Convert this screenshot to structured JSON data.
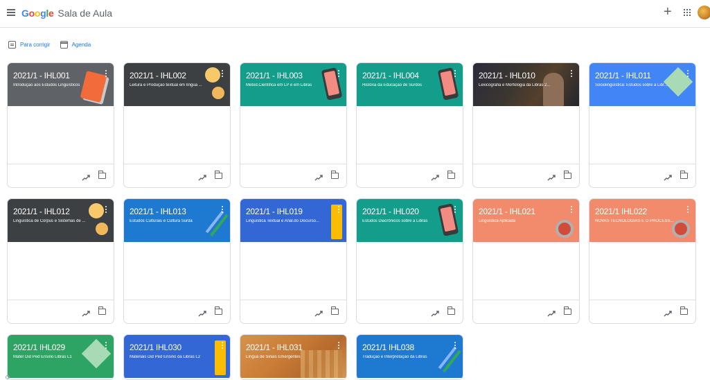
{
  "header": {
    "google_letters": [
      "G",
      "o",
      "o",
      "g",
      "l",
      "e"
    ],
    "app_name": "Sala de Aula"
  },
  "actions": {
    "review_label": "Para corrigir",
    "agenda_label": "Agenda"
  },
  "cards": [
    {
      "title": "2021/1 - IHL001",
      "subtitle": "Introdução aos Estudos Linguísticos",
      "color": "#5f6368"
    },
    {
      "title": "2021/1 - IHL002",
      "subtitle": "Leitura e Produção textual em língua ...",
      "color": "#3c4043"
    },
    {
      "title": "2021/1 - IHL003",
      "subtitle": "Metod.Científica em LP e em Libras",
      "color": "#129e8a"
    },
    {
      "title": "2021/1 - IHL004",
      "subtitle": "História da Educação de Surdos",
      "color": "#129e8a"
    },
    {
      "title": "2021/1 - IHL010",
      "subtitle": "Lexicografia e Morfologia da Libras 2...",
      "color": "#2c2b3a"
    },
    {
      "title": "2021/1 - IHL011",
      "subtitle": "Sociolinguística: Estudos sobre a Libr...",
      "color": "#4285f4"
    },
    {
      "title": "2021/1 - IHL012",
      "subtitle": "Linguística de Corpus e Sistemas de ...",
      "color": "#3c4043"
    },
    {
      "title": "2021/1 - IHL013",
      "subtitle": "Estudos Culturais e Cultura Surda",
      "color": "#1e7ad0"
    },
    {
      "title": "2021/1 - IHL019",
      "subtitle": "Linguística Textual e Anál.do Discurso...",
      "color": "#3367d6"
    },
    {
      "title": "2021/1 - IHL020",
      "subtitle": "Estudos Diacrônicos sobre a Libras",
      "color": "#129e8a"
    },
    {
      "title": "2021/1 - IHL021",
      "subtitle": "Linguística Aplicada",
      "color": "#f28b6b"
    },
    {
      "title": "2021/1 IHL022",
      "subtitle": "NOVAS TECNOLOGIAS E O PROCESS...",
      "color": "#f28b6b"
    },
    {
      "title": "2021/1 IHL029",
      "subtitle": "Mater Did Ped Ensino Libras L1",
      "color": "#2ea464"
    },
    {
      "title": "2021/1 IHL030",
      "subtitle": "Materiais Did Ped Ensino da Libras L2",
      "color": "#3367d6"
    },
    {
      "title": "2021/1 - IHL031",
      "subtitle": "Língua de Sinais Emergentes",
      "color": "#c87b35"
    },
    {
      "title": "2021/1 IHL038",
      "subtitle": "Tradução e Interpretação da Libras",
      "color": "#1e7ad0"
    }
  ]
}
